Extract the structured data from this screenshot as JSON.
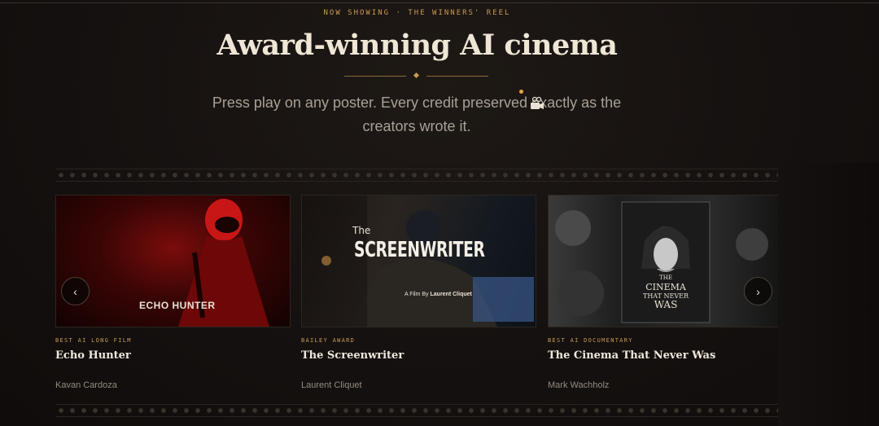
{
  "hero": {
    "eyebrow": "NOW SHOWING · THE WINNERS' REEL",
    "title": "Award-winning AI cinema",
    "subtitle": "Press play on any poster. Every credit preserved exactly as the creators wrote it."
  },
  "films": [
    {
      "award": "BEST AI LONG FILM",
      "title": "Echo Hunter",
      "credit": "Kavan Cardoza",
      "poster_text": "ECHO HUNTER"
    },
    {
      "award": "BAILEY AWARD",
      "title": "The Screenwriter",
      "credit": "Laurent Cliquet",
      "poster_small": "The",
      "poster_text": "SCREENWRITER",
      "poster_tagline_prefix": "A Film By",
      "poster_tagline_name": "Laurent Cliquet"
    },
    {
      "award": "BEST AI DOCUMENTARY",
      "title": "The Cinema That Never Was",
      "credit": "Mark Wachholz",
      "poster_small": "THE",
      "poster_line1": "CINEMA",
      "poster_line2": "THAT NEVER",
      "poster_line3": "WAS"
    }
  ],
  "carousel": {
    "prev_label": "‹",
    "next_label": "›"
  },
  "colors": {
    "accent": "#c99a55",
    "background": "#161210"
  },
  "icons": [
    "camera-icon",
    "chevron-left-icon",
    "chevron-right-icon"
  ]
}
